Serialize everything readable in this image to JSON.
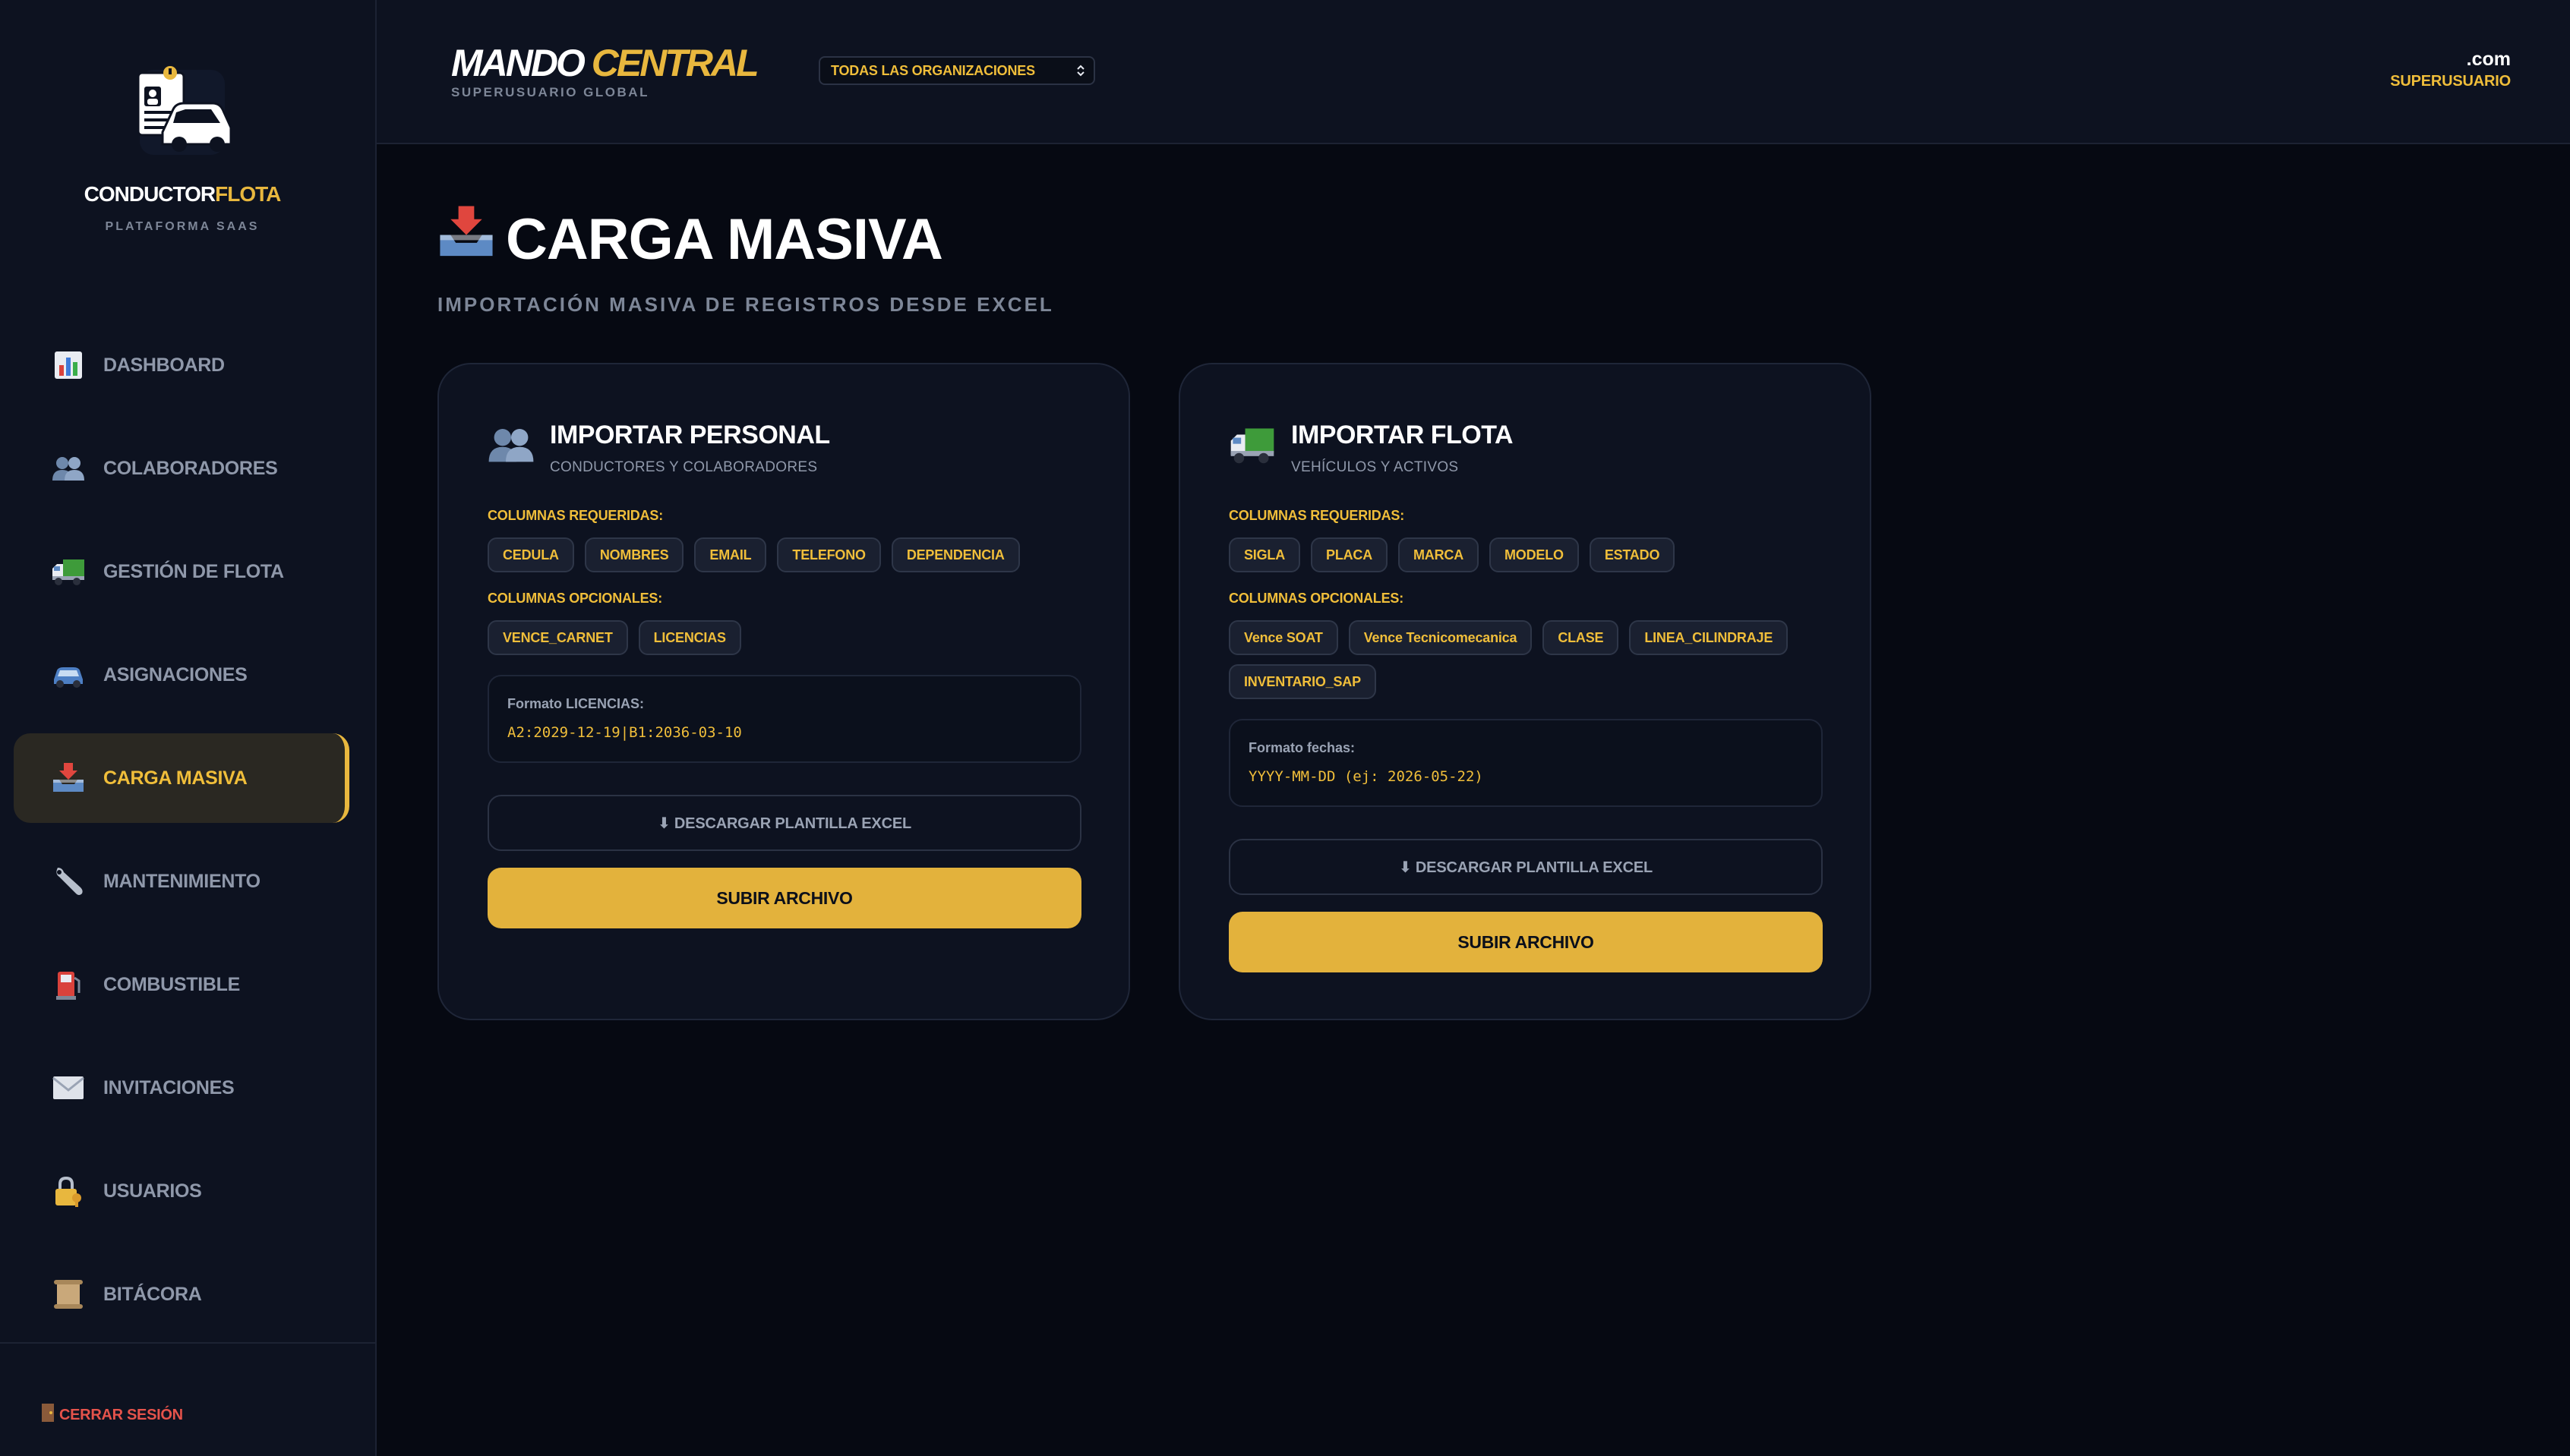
{
  "brand": {
    "name_part1": "CONDUCTOR",
    "name_part2": "FLOTA",
    "subtitle": "PLATAFORMA SAAS"
  },
  "sidebar": {
    "items": [
      {
        "label": "DASHBOARD",
        "icon": "bar-chart-icon"
      },
      {
        "label": "COLABORADORES",
        "icon": "people-icon"
      },
      {
        "label": "GESTIÓN DE FLOTA",
        "icon": "truck-icon"
      },
      {
        "label": "ASIGNACIONES",
        "icon": "car-icon"
      },
      {
        "label": "CARGA MASIVA",
        "icon": "inbox-tray-icon",
        "active": true
      },
      {
        "label": "MANTENIMIENTO",
        "icon": "wrench-icon"
      },
      {
        "label": "COMBUSTIBLE",
        "icon": "fuel-pump-icon"
      },
      {
        "label": "INVITACIONES",
        "icon": "envelope-icon"
      },
      {
        "label": "USUARIOS",
        "icon": "lock-key-icon"
      },
      {
        "label": "BITÁCORA",
        "icon": "scroll-icon"
      }
    ],
    "logout_label": "CERRAR SESIÓN"
  },
  "header": {
    "title_part1": "MANDO",
    "title_part2": "CENTRAL",
    "subtitle": "SUPERUSUARIO GLOBAL",
    "org_select_value": "TODAS LAS ORGANIZACIONES",
    "user_domain": ".com",
    "user_role": "SUPERUSUARIO"
  },
  "page": {
    "title": "CARGA MASIVA",
    "subtitle": "IMPORTACIÓN MASIVA DE REGISTROS DESDE EXCEL"
  },
  "cards": {
    "personal": {
      "title": "IMPORTAR PERSONAL",
      "subtitle": "CONDUCTORES Y COLABORADORES",
      "required_label": "COLUMNAS REQUERIDAS:",
      "required": [
        "CEDULA",
        "NOMBRES",
        "EMAIL",
        "TELEFONO",
        "DEPENDENCIA"
      ],
      "optional_label": "COLUMNAS OPCIONALES:",
      "optional": [
        "VENCE_CARNET",
        "LICENCIAS"
      ],
      "format_label": "Formato LICENCIAS:",
      "format_value": "A2:2029-12-19|B1:2036-03-10",
      "download_label": "⬇ DESCARGAR PLANTILLA EXCEL",
      "upload_label": "SUBIR ARCHIVO"
    },
    "flota": {
      "title": "IMPORTAR FLOTA",
      "subtitle": "VEHÍCULOS Y ACTIVOS",
      "required_label": "COLUMNAS REQUERIDAS:",
      "required": [
        "SIGLA",
        "PLACA",
        "MARCA",
        "MODELO",
        "ESTADO"
      ],
      "optional_label": "COLUMNAS OPCIONALES:",
      "optional": [
        "Vence SOAT",
        "Vence Tecnicomecanica",
        "CLASE",
        "LINEA_CILINDRAJE",
        "INVENTARIO_SAP"
      ],
      "format_label": "Formato fechas:",
      "format_value": "YYYY-MM-DD (ej: 2026-05-22)",
      "download_label": "⬇ DESCARGAR PLANTILLA EXCEL",
      "upload_label": "SUBIR ARCHIVO"
    }
  },
  "colors": {
    "accent": "#e8b73e",
    "background": "#060912",
    "panel": "#0d1220",
    "danger": "#e5534b"
  }
}
